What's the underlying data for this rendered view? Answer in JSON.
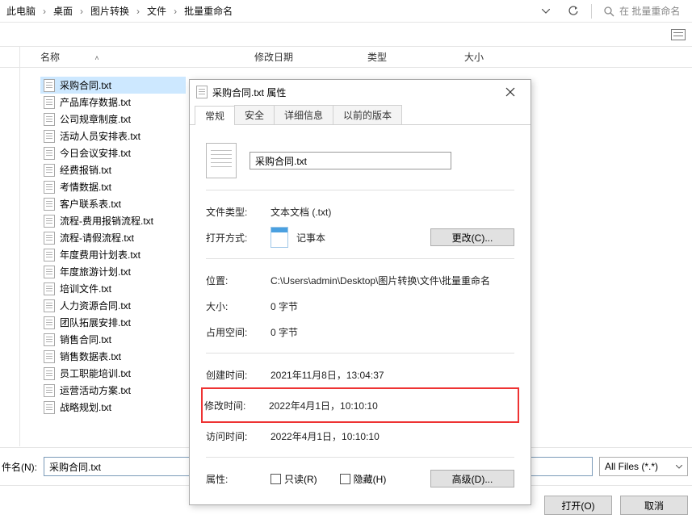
{
  "breadcrumb": [
    "此电脑",
    "桌面",
    "图片转换",
    "文件",
    "批量重命名"
  ],
  "search_placeholder": "在 批量重命名",
  "columns": {
    "name": "名称",
    "date": "修改日期",
    "type": "类型",
    "size": "大小"
  },
  "files": [
    "采购合同.txt",
    "产品库存数据.txt",
    "公司规章制度.txt",
    "活动人员安排表.txt",
    "今日会议安排.txt",
    "经费报销.txt",
    "考情数据.txt",
    "客户联系表.txt",
    "流程-费用报销流程.txt",
    "流程-请假流程.txt",
    "年度费用计划表.txt",
    "年度旅游计划.txt",
    "培训文件.txt",
    "人力资源合同.txt",
    "团队拓展安排.txt",
    "销售合同.txt",
    "销售数据表.txt",
    "员工职能培训.txt",
    "运营活动方案.txt",
    "战略规划.txt"
  ],
  "selected_index": 0,
  "bottom": {
    "filename_label": "件名(N):",
    "filename_value": "采购合同.txt",
    "filter": "All Files (*.*)",
    "open": "打开(O)",
    "cancel": "取消"
  },
  "props": {
    "title": "采购合同.txt 属性",
    "tabs": [
      "常规",
      "安全",
      "详细信息",
      "以前的版本"
    ],
    "filename": "采购合同.txt",
    "labels": {
      "filetype": "文件类型:",
      "openwith": "打开方式:",
      "location": "位置:",
      "size": "大小:",
      "ondisk": "占用空间:",
      "created": "创建时间:",
      "modified": "修改时间:",
      "accessed": "访问时间:",
      "attributes": "属性:"
    },
    "values": {
      "filetype": "文本文档 (.txt)",
      "openwith": "记事本",
      "location": "C:\\Users\\admin\\Desktop\\图片转换\\文件\\批量重命名",
      "size": "0 字节",
      "ondisk": "0 字节",
      "created": "2021年11月8日，13:04:37",
      "modified": "2022年4月1日，10:10:10",
      "accessed": "2022年4月1日，10:10:10"
    },
    "buttons": {
      "change": "更改(C)...",
      "advanced": "高级(D)..."
    },
    "checkboxes": {
      "readonly": "只读(R)",
      "hidden": "隐藏(H)"
    }
  }
}
